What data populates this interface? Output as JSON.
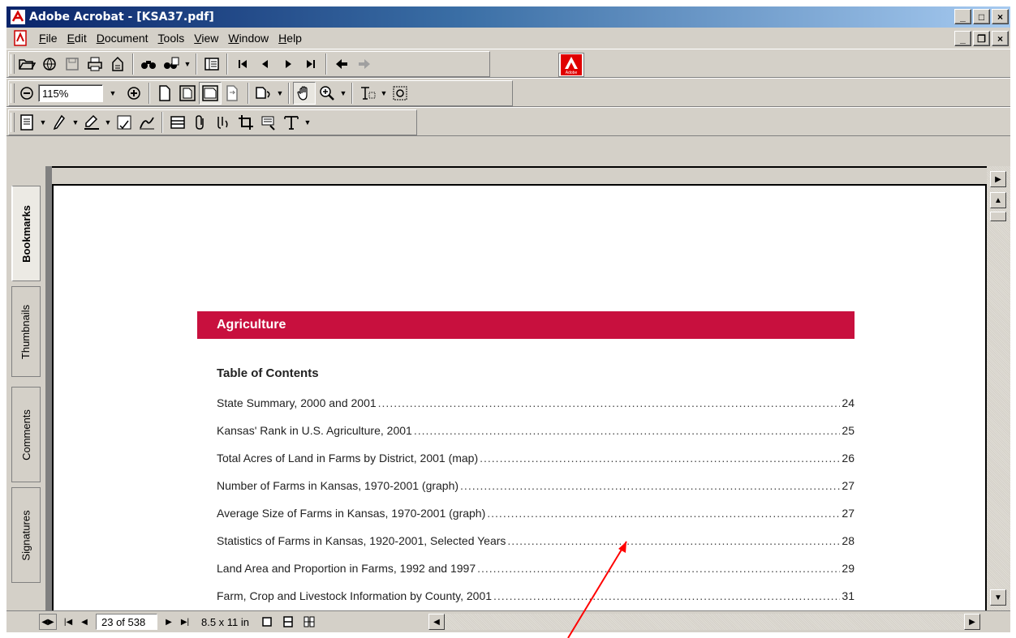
{
  "window": {
    "title": "Adobe Acrobat - [KSA37.pdf]",
    "controls": {
      "minimize": "_",
      "maximize": "□",
      "close": "×"
    }
  },
  "menubar": {
    "items": [
      {
        "label": "File",
        "underline": "F",
        "rest": "ile"
      },
      {
        "label": "Edit",
        "underline": "E",
        "rest": "dit"
      },
      {
        "label": "Document",
        "underline": "D",
        "rest": "ocument"
      },
      {
        "label": "Tools",
        "underline": "T",
        "rest": "ools"
      },
      {
        "label": "View",
        "underline": "V",
        "rest": "iew"
      },
      {
        "label": "Window",
        "underline": "W",
        "rest": "indow"
      },
      {
        "label": "Help",
        "underline": "H",
        "rest": "elp"
      }
    ],
    "doc_controls": {
      "minimize": "_",
      "restore": "❐",
      "close": "×"
    }
  },
  "toolbar": {
    "zoom_value": "115%",
    "adobe_logo_text": "Adobe"
  },
  "nav_tabs": [
    {
      "label": "Bookmarks",
      "active": true
    },
    {
      "label": "Thumbnails",
      "active": false
    },
    {
      "label": "Comments",
      "active": false
    },
    {
      "label": "Signatures",
      "active": false
    }
  ],
  "document": {
    "section_title": "Agriculture",
    "toc_heading": "Table of Contents",
    "toc": [
      {
        "title": "State Summary, 2000 and 2001",
        "page": "24"
      },
      {
        "title": "Kansas' Rank in U.S. Agriculture, 2001",
        "page": "25"
      },
      {
        "title": "Total Acres of Land in Farms by District, 2001 (map)",
        "page": "26"
      },
      {
        "title": "Number of Farms in Kansas, 1970-2001 (graph)",
        "page": "27"
      },
      {
        "title": "Average Size of Farms in Kansas, 1970-2001 (graph)",
        "page": "27"
      },
      {
        "title": "Statistics of Farms in Kansas, 1920-2001, Selected Years",
        "page": "28"
      },
      {
        "title": "Land Area and Proportion in Farms, 1992 and 1997",
        "page": "29"
      },
      {
        "title": "Farm, Crop and Livestock Information by County, 2001",
        "page": "31"
      }
    ],
    "banner_color": "#c8103e"
  },
  "statusbar": {
    "page_indicator": "23 of 538",
    "page_size": "8.5 x 11 in"
  },
  "annotation": {
    "arrow_color": "#ff0000"
  }
}
